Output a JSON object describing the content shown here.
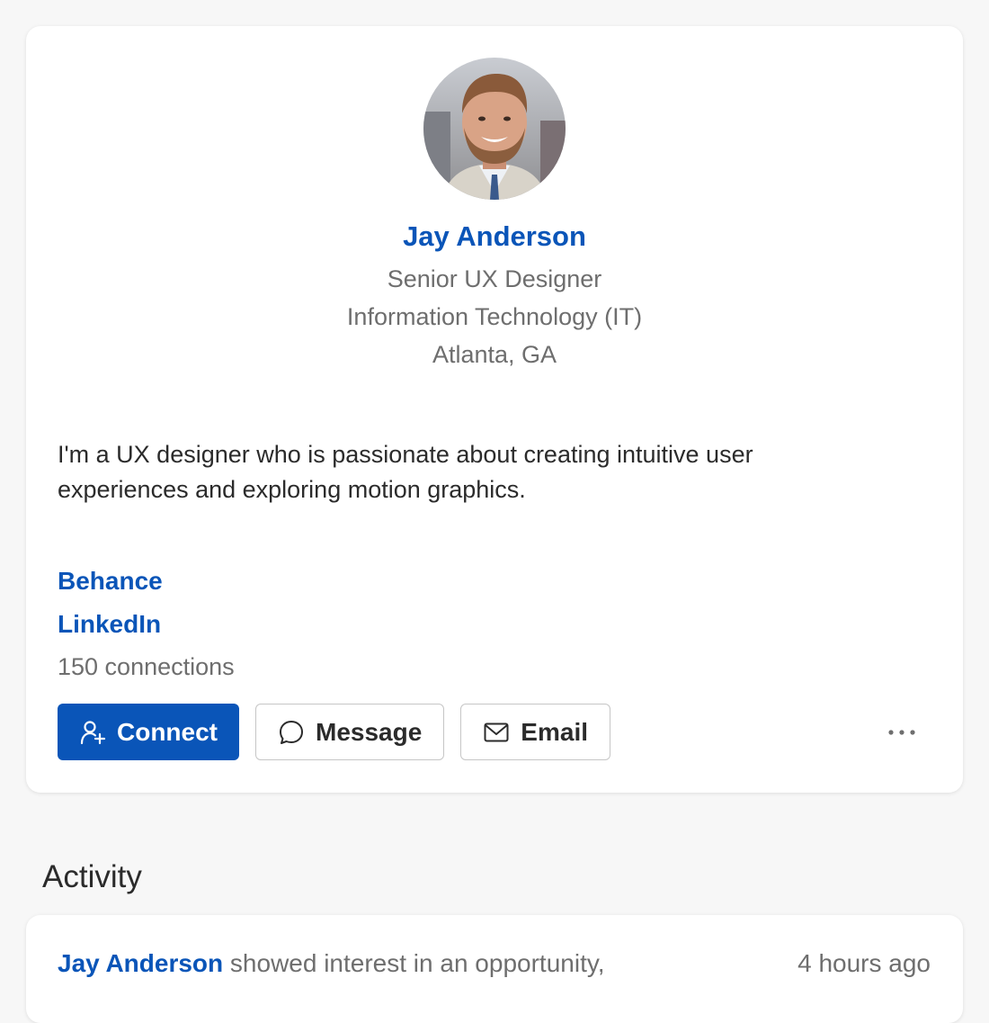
{
  "profile": {
    "avatar_icon": "user-photo",
    "name": "Jay Anderson",
    "title": "Senior UX Designer",
    "department": "Information Technology (IT)",
    "location": "Atlanta, GA",
    "bio": "I'm a UX designer who is passionate about creating intuitive user experiences and exploring motion graphics.",
    "links": [
      {
        "label": "Behance"
      },
      {
        "label": "LinkedIn"
      }
    ],
    "connections": "150 connections",
    "actions": {
      "connect_label": "Connect",
      "message_label": "Message",
      "email_label": "Email"
    }
  },
  "activity": {
    "section_title": "Activity",
    "items": [
      {
        "actor": "Jay Anderson",
        "text": "showed interest in an opportunity,",
        "time": "4 hours ago"
      }
    ]
  },
  "colors": {
    "accent": "#0a55b8",
    "background": "#f7f7f7",
    "card": "#ffffff",
    "muted_text": "#6e6e6e"
  }
}
